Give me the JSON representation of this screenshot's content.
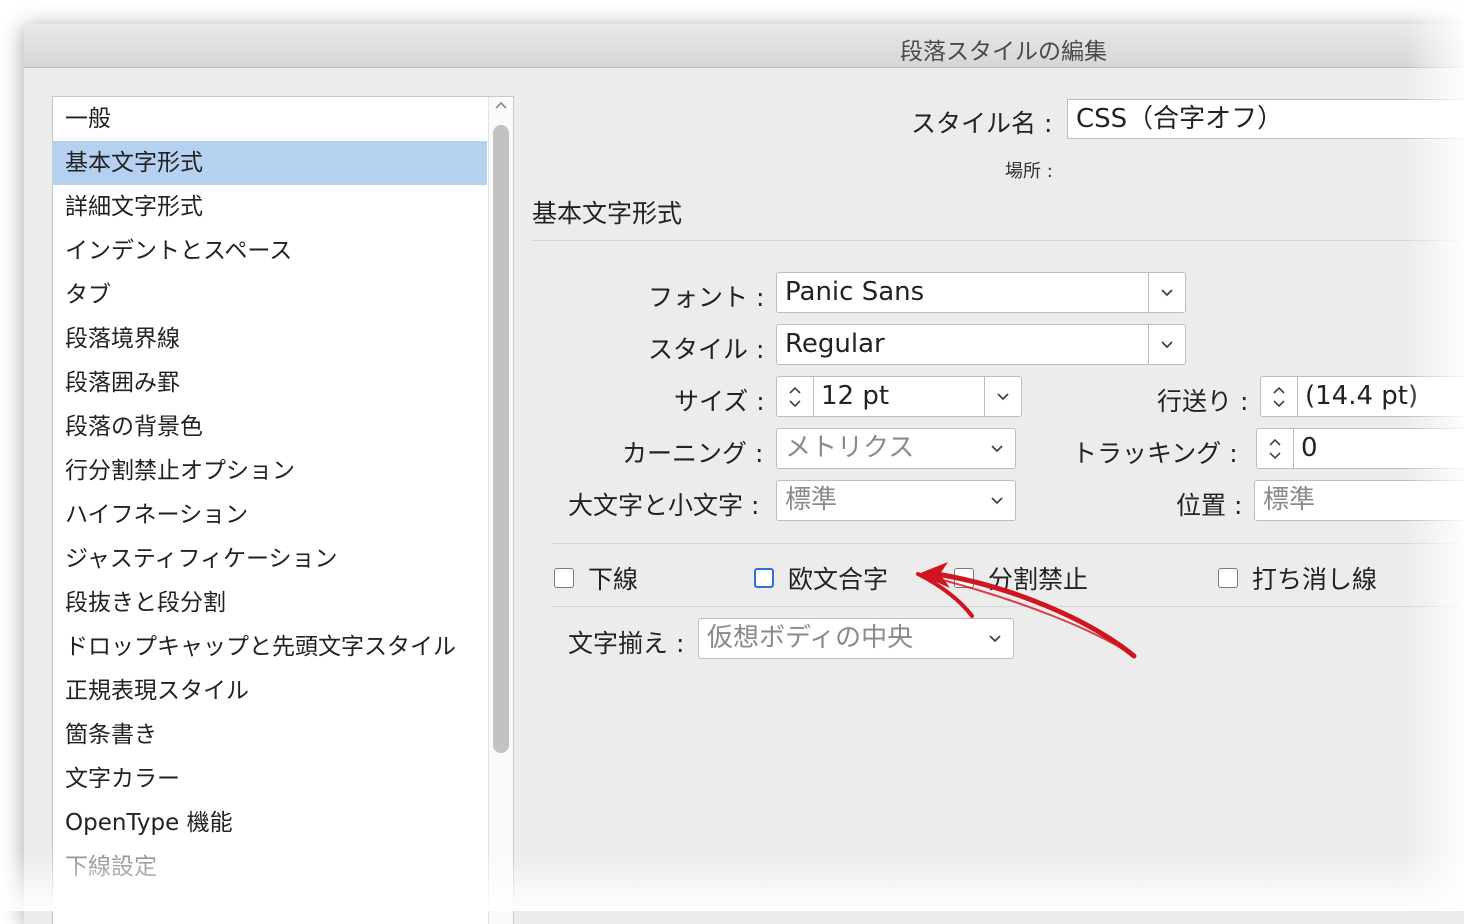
{
  "window": {
    "title": "段落スタイルの編集"
  },
  "sidebar": {
    "selected_index": 1,
    "items": [
      "一般",
      "基本文字形式",
      "詳細文字形式",
      "インデントとスペース",
      "タブ",
      "段落境界線",
      "段落囲み罫",
      "段落の背景色",
      "行分割禁止オプション",
      "ハイフネーション",
      "ジャスティフィケーション",
      "段抜きと段分割",
      "ドロップキャップと先頭文字スタイル",
      "正規表現スタイル",
      "箇条書き",
      "文字カラー",
      "OpenType 機能",
      "下線設定"
    ]
  },
  "header": {
    "style_name_label": "スタイル名 :",
    "style_name_value": "CSS（合字オフ）",
    "location_label": "場所 :"
  },
  "section": {
    "title": "基本文字形式"
  },
  "fields": {
    "font_label": "フォント :",
    "font_value": "Panic Sans",
    "style_label": "スタイル :",
    "style_value": "Regular",
    "size_label": "サイズ :",
    "size_value": "12 pt",
    "leading_label": "行送り :",
    "leading_value": "(14.4 pt)",
    "kerning_label": "カーニング :",
    "kerning_value": "メトリクス",
    "tracking_label": "トラッキング :",
    "tracking_value": "0",
    "case_label": "大文字と小文字 :",
    "case_value": "標準",
    "position_label": "位置 :",
    "position_value": "標準"
  },
  "checkboxes": [
    {
      "label": "下線",
      "checked": false
    },
    {
      "label": "欧文合字",
      "checked": false,
      "focused": true
    },
    {
      "label": "分割禁止",
      "checked": false
    },
    {
      "label": "打ち消し線",
      "checked": false
    }
  ],
  "alignment": {
    "label": "文字揃え :",
    "value": "仮想ボディの中央"
  },
  "annotation": {
    "arrow_color": "#d0151f"
  }
}
